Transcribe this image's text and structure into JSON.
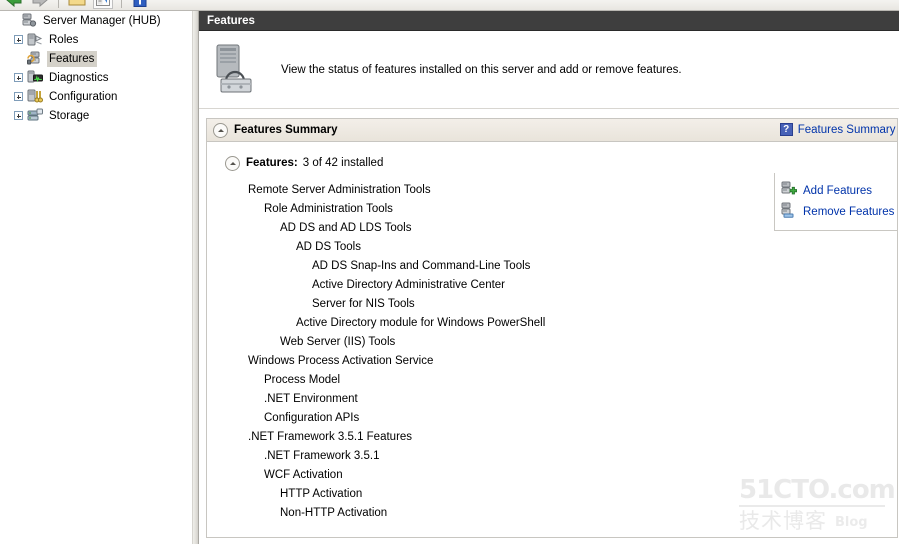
{
  "toolbar": {
    "buttons": [
      {
        "name": "back-arrow-icon",
        "label": "Back"
      },
      {
        "name": "forward-arrow-icon",
        "label": "Forward"
      },
      {
        "name": "folder-up-icon",
        "label": "Up"
      },
      {
        "name": "show-hide-tree-icon",
        "label": "Show/Hide Console Tree"
      },
      {
        "name": "properties-icon",
        "label": "Properties"
      }
    ]
  },
  "tree": {
    "root": {
      "label": "Server Manager (HUB)",
      "icon": "server-manager-icon"
    },
    "items": [
      {
        "label": "Roles",
        "icon": "roles-icon",
        "expandable": true,
        "selected": false
      },
      {
        "label": "Features",
        "icon": "features-icon",
        "expandable": false,
        "selected": true
      },
      {
        "label": "Diagnostics",
        "icon": "diagnostics-icon",
        "expandable": true,
        "selected": false
      },
      {
        "label": "Configuration",
        "icon": "configuration-icon",
        "expandable": true,
        "selected": false
      },
      {
        "label": "Storage",
        "icon": "storage-icon",
        "expandable": true,
        "selected": false
      }
    ]
  },
  "page": {
    "header_title": "Features",
    "banner_text": "View the status of features installed on this server and add or remove features.",
    "banner_icon": "server-tools-icon"
  },
  "summary": {
    "title": "Features Summary",
    "help_label": "Features Summary H",
    "help_icon": "help-question-icon",
    "features_label": "Features:",
    "features_count": "3 of 42 installed",
    "installed_features": [
      {
        "label": "Remote Server Administration Tools",
        "indent": 0
      },
      {
        "label": "Role Administration Tools",
        "indent": 1
      },
      {
        "label": "AD DS and AD LDS Tools",
        "indent": 2
      },
      {
        "label": "AD DS Tools",
        "indent": 3
      },
      {
        "label": "AD DS Snap-Ins and Command-Line Tools",
        "indent": 4
      },
      {
        "label": "Active Directory Administrative Center",
        "indent": 4
      },
      {
        "label": "Server for NIS Tools",
        "indent": 4
      },
      {
        "label": "Active Directory module for Windows PowerShell",
        "indent": 3
      },
      {
        "label": "Web Server (IIS) Tools",
        "indent": 2
      },
      {
        "label": "Windows Process Activation Service",
        "indent": 0
      },
      {
        "label": "Process Model",
        "indent": 1
      },
      {
        "label": ".NET Environment",
        "indent": 1
      },
      {
        "label": "Configuration APIs",
        "indent": 1
      },
      {
        "label": ".NET Framework 3.5.1 Features",
        "indent": 0
      },
      {
        "label": ".NET Framework 3.5.1",
        "indent": 1
      },
      {
        "label": "WCF Activation",
        "indent": 1
      },
      {
        "label": "HTTP Activation",
        "indent": 2
      },
      {
        "label": "Non-HTTP Activation",
        "indent": 2
      }
    ]
  },
  "actions": {
    "items": [
      {
        "label": "Add Features",
        "icon": "add-features-icon"
      },
      {
        "label": "Remove Features",
        "icon": "remove-features-icon"
      }
    ]
  },
  "watermark": {
    "top": "51CTO.com",
    "bottom_cn": "技术博客",
    "bottom_en": "Blog"
  },
  "colors": {
    "header_bar": "#3e3e3e",
    "link": "#0033aa",
    "selection": "#d4d1c9",
    "panel_border": "#c8c6c1"
  }
}
